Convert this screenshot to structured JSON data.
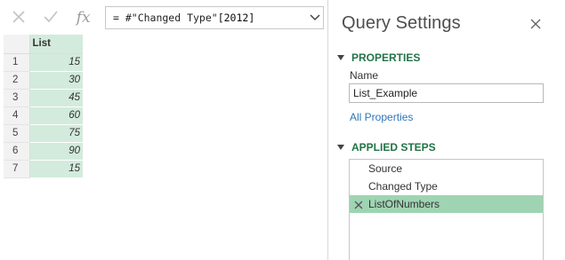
{
  "formula_bar": {
    "cancel_icon": "close-icon",
    "commit_icon": "check-icon",
    "fx_label": "fx",
    "formula_prefix": "= #\"Changed Type\"",
    "formula_index": "[2012]"
  },
  "grid": {
    "column_header": "List",
    "rows": [
      {
        "num": "1",
        "value": "15"
      },
      {
        "num": "2",
        "value": "30"
      },
      {
        "num": "3",
        "value": "45"
      },
      {
        "num": "4",
        "value": "60"
      },
      {
        "num": "5",
        "value": "75"
      },
      {
        "num": "6",
        "value": "90"
      },
      {
        "num": "7",
        "value": "15"
      }
    ]
  },
  "query_settings": {
    "title": "Query Settings",
    "properties_header": "PROPERTIES",
    "name_label": "Name",
    "name_value": "List_Example",
    "all_properties_link": "All Properties",
    "applied_steps_header": "APPLIED STEPS",
    "steps": [
      {
        "label": "Source",
        "selected": false
      },
      {
        "label": "Changed Type",
        "selected": false
      },
      {
        "label": "ListOfNumbers",
        "selected": true
      }
    ]
  },
  "colors": {
    "accent_green": "#217346",
    "cell_green": "#d3ebdc",
    "selected_step": "#9fd4b2",
    "link_blue": "#2e75b6"
  }
}
